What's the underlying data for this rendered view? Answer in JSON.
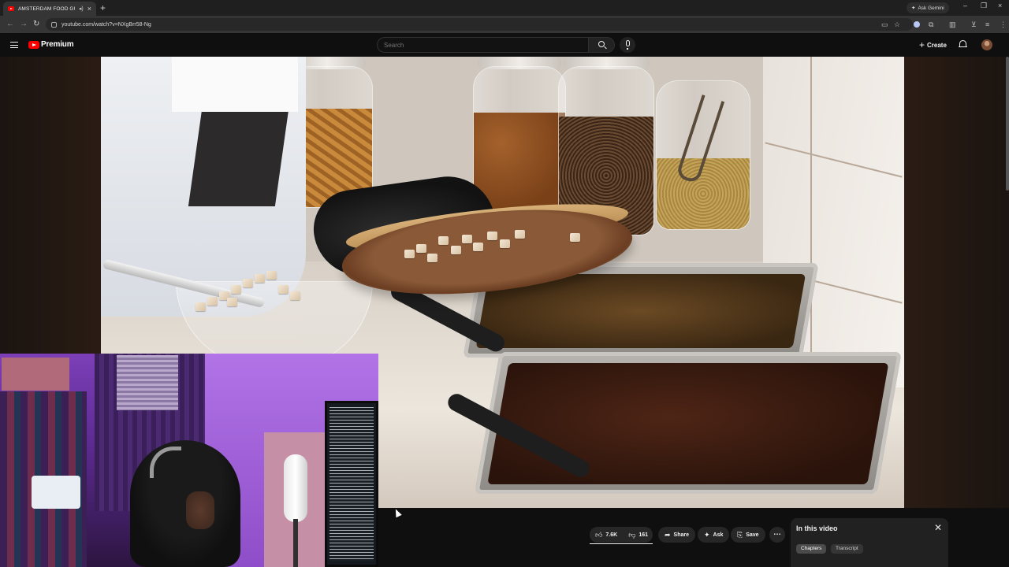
{
  "browser": {
    "tab_title": "AMSTERDAM FOOD GUIDE",
    "url": "youtube.com/watch?v=NXgBrr58-Ng",
    "gemini_label": "Ask Gemini",
    "icons": [
      "speaker-icon",
      "close-icon",
      "plus-icon",
      "back-icon",
      "forward-icon",
      "reload-icon",
      "cast-icon",
      "star-icon",
      "extensions-icon",
      "sidepanel-icon",
      "menu-icon"
    ]
  },
  "youtube": {
    "brand": "Premium",
    "brand_color": "#ff0000",
    "search_placeholder": "Search",
    "create_label": "Create"
  },
  "actions": {
    "likes": "7.6K",
    "dislikes": "161",
    "share": "Share",
    "ask": "Ask",
    "save": "Save"
  },
  "panel": {
    "title": "In this video",
    "chips": [
      "Chapters",
      "Transcript"
    ]
  }
}
